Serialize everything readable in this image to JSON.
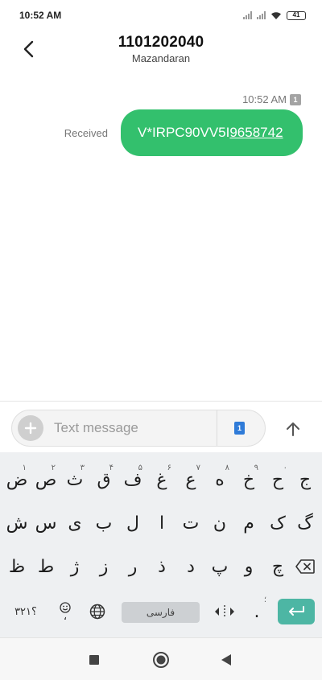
{
  "status_bar": {
    "time": "10:52 AM",
    "battery": "41",
    "icons": [
      "signal-icon",
      "signal-icon",
      "wifi-icon",
      "battery-icon"
    ]
  },
  "header": {
    "title": "1101202040",
    "subtitle": "Mazandaran",
    "back_icon": "chevron-left-icon"
  },
  "message": {
    "time": "10:52 AM",
    "sim": "1",
    "status": "Received",
    "text_prefix": "V*IRPC90VV5I",
    "text_link": "9658742",
    "bubble_color": "#33c06d"
  },
  "compose": {
    "placeholder": "Text message",
    "sim": "1",
    "icons": [
      "plus-icon",
      "send-arrow-icon"
    ]
  },
  "keyboard": {
    "row1": [
      {
        "char": "ض",
        "hint": "۱"
      },
      {
        "char": "ص",
        "hint": "۲"
      },
      {
        "char": "ث",
        "hint": "۳"
      },
      {
        "char": "ق",
        "hint": "۴"
      },
      {
        "char": "ف",
        "hint": "۵"
      },
      {
        "char": "غ",
        "hint": "۶"
      },
      {
        "char": "ع",
        "hint": "۷"
      },
      {
        "char": "ه",
        "hint": "۸"
      },
      {
        "char": "خ",
        "hint": "۹"
      },
      {
        "char": "ح",
        "hint": "۰"
      },
      {
        "char": "ج",
        "hint": ""
      }
    ],
    "row2": [
      "ش",
      "س",
      "ی",
      "ب",
      "ل",
      "ا",
      "ت",
      "ن",
      "م",
      "ک",
      "گ"
    ],
    "row3": [
      "ظ",
      "ط",
      "ژ",
      "ز",
      "ر",
      "ذ",
      "د",
      "پ",
      "و",
      "چ"
    ],
    "row4": {
      "numbers": "؟۳۲۱",
      "emoji_sub": "،",
      "lang": "فارسی",
      "period": ".",
      "period_hint": "؛"
    },
    "enter_color": "#4db6a4"
  },
  "navbar": {
    "icons": [
      "square-recents-icon",
      "circle-home-icon",
      "triangle-back-icon"
    ]
  }
}
